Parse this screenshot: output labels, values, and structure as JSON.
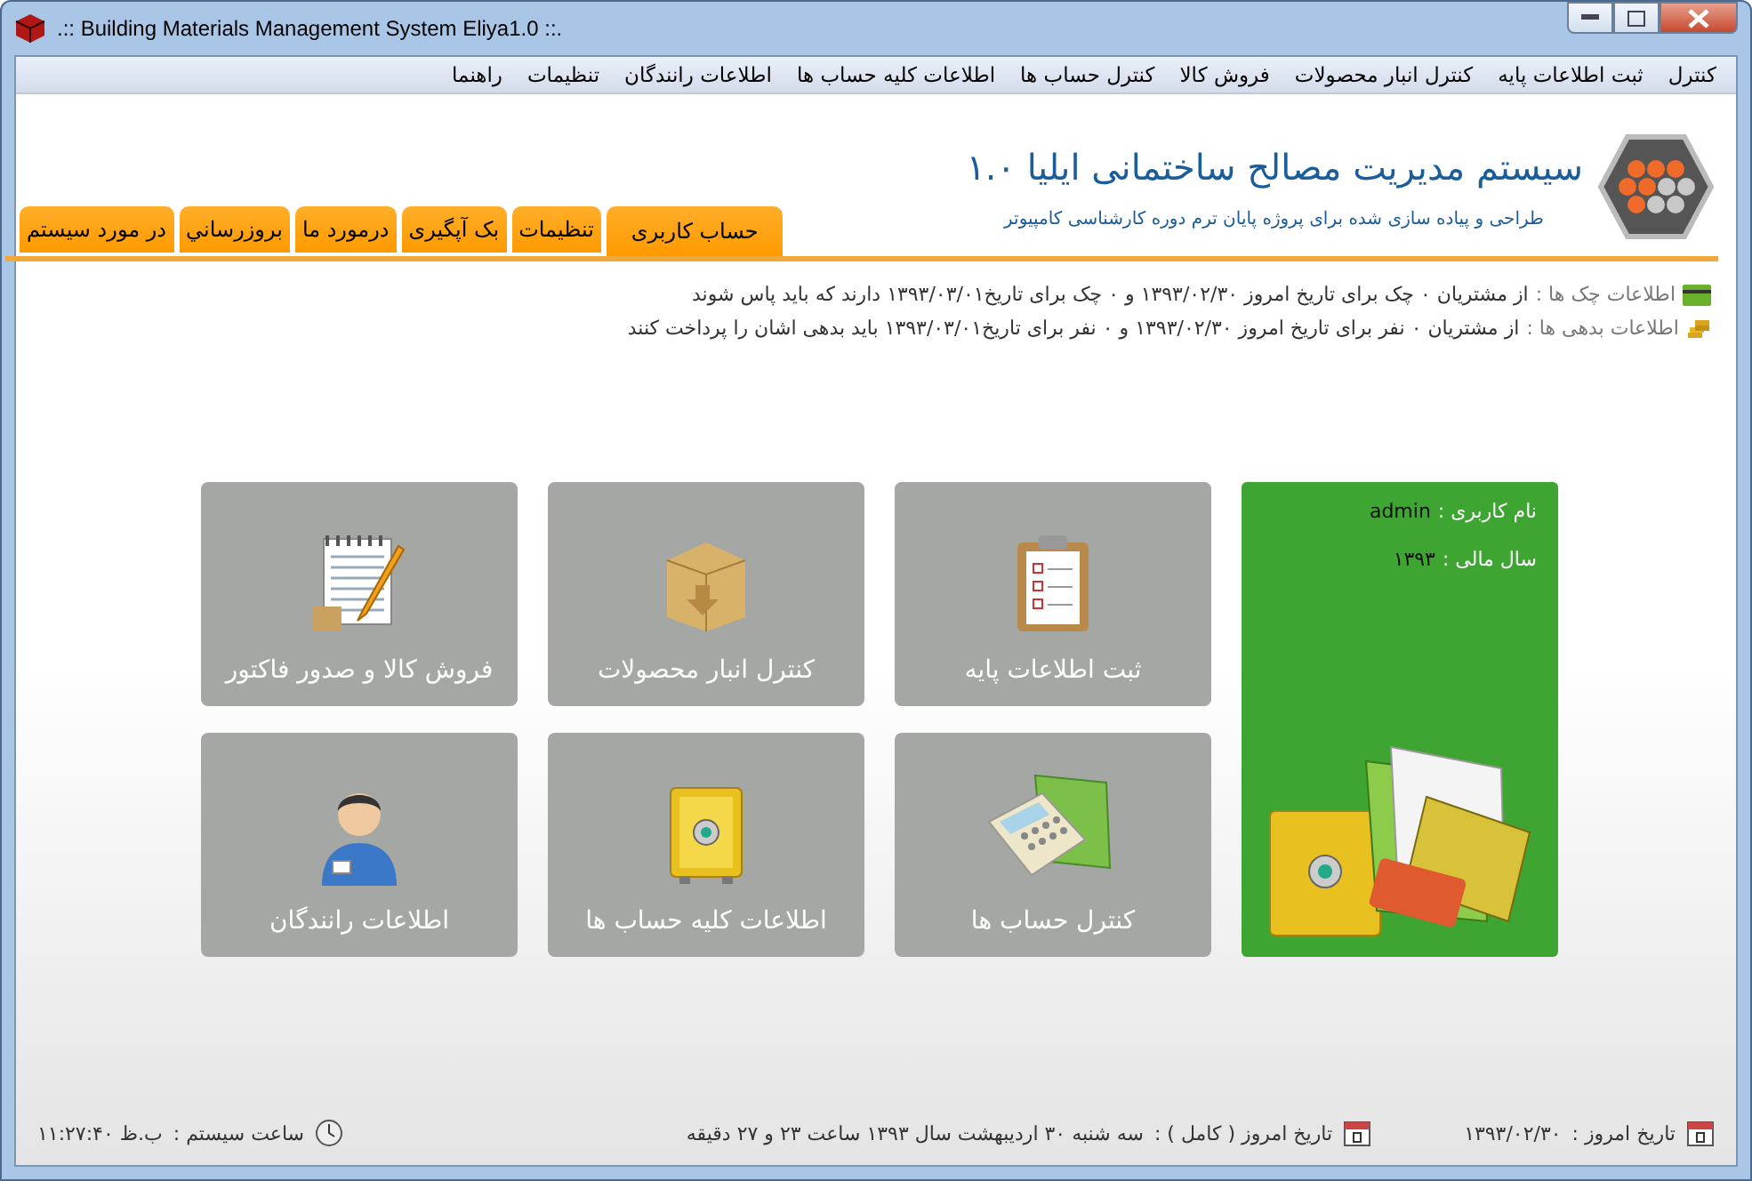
{
  "window": {
    "title": ".:: Building Materials Management System Eliya1.0 ::."
  },
  "menu": [
    "کنترل",
    "ثبت اطلاعات پایه",
    "کنترل انبار محصولات",
    "فروش کالا",
    "کنترل حساب ها",
    "اطلاعات کلیه حساب ها",
    "اطلاعات رانندگان",
    "تنظیمات",
    "راهنما"
  ],
  "header": {
    "title": "سیستم مدیریت مصالح ساختمانی ایلیا ۱.۰",
    "subtitle": "طراحی و پیاده سازی شده برای پروژه پایان ترم دوره کارشناسی کامپیوتر"
  },
  "tabs": [
    {
      "label": "حساب کاربری",
      "selected": true
    },
    {
      "label": "تنظیمات",
      "selected": false
    },
    {
      "label": "بک آپگیری",
      "selected": false
    },
    {
      "label": "درمورد ما",
      "selected": false
    },
    {
      "label": "بروزرساني",
      "selected": false
    },
    {
      "label": "در مورد سیستم",
      "selected": false
    }
  ],
  "notices": [
    {
      "kind": "checks",
      "label": "اطلاعات چک ها :",
      "text": "از مشتریان ۰ چک برای تاریخ امروز ۱۳۹۳/۰۲/۳۰ و ۰ چک برای تاریخ۱۳۹۳/۰۳/۰۱ دارند که باید پاس شوند"
    },
    {
      "kind": "debts",
      "label": "اطلاعات بدهی ها :",
      "text": "از مشتریان ۰ نفر برای تاریخ امروز ۱۳۹۳/۰۲/۳۰ و ۰ نفر برای تاریخ۱۳۹۳/۰۳/۰۱ باید بدهی اشان را پرداخت کنند"
    }
  ],
  "user_card": {
    "username_label": "نام کاربری :",
    "username": "admin",
    "year_label": "سال مالی :",
    "year": "۱۳۹۳"
  },
  "tiles": [
    {
      "kind": "clipboard",
      "label": "ثبت اطلاعات پایه"
    },
    {
      "kind": "box",
      "label": "کنترل انبار محصولات"
    },
    {
      "kind": "notepad",
      "label": "فروش کالا و صدور فاکتور"
    },
    {
      "kind": "calculator",
      "label": "کنترل حساب ها"
    },
    {
      "kind": "safe",
      "label": "اطلاعات کلیه حساب ها"
    },
    {
      "kind": "person",
      "label": "اطلاعات رانندگان"
    }
  ],
  "status_bar": {
    "date_label": "تاریخ امروز :",
    "date": "۱۳۹۳/۰۲/۳۰",
    "full_date_label": "تاریخ امروز ( کامل ) :",
    "full_date": "سه شنبه ۳۰ اردیبهشت سال ۱۳۹۳ ساعت ۲۳ و ۲۷ دقیقه",
    "time_label": "ساعت سیستم :",
    "time": "ب.ظ ۱۱:۲۷:۴۰"
  }
}
